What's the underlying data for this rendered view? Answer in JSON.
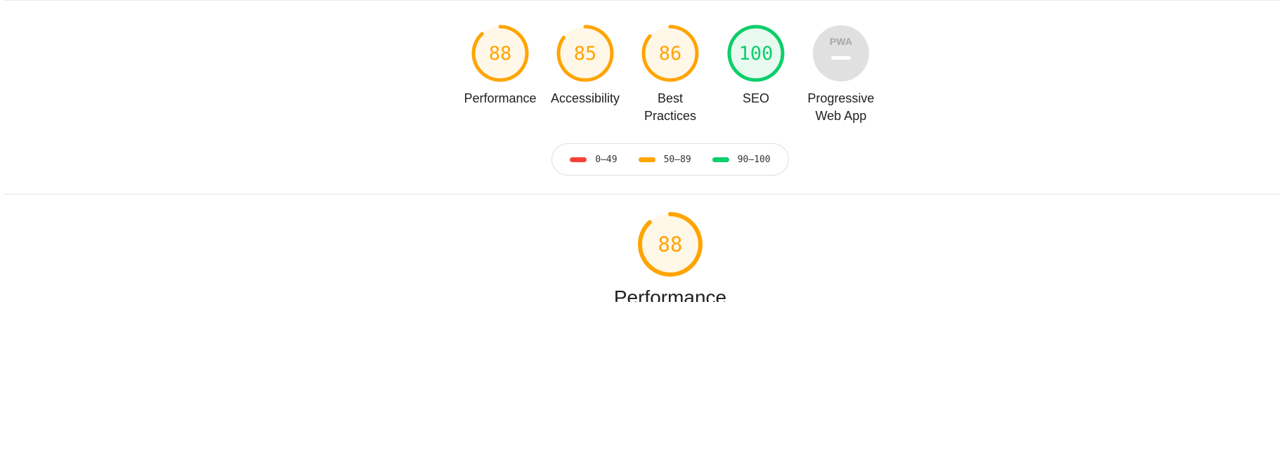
{
  "categories": [
    {
      "id": "performance",
      "label_lines": [
        "Performance"
      ],
      "score": "88",
      "rating": "average"
    },
    {
      "id": "accessibility",
      "label_lines": [
        "Accessibility"
      ],
      "score": "85",
      "rating": "average"
    },
    {
      "id": "best-practices",
      "label_lines": [
        "Best",
        "Practices"
      ],
      "score": "86",
      "rating": "average"
    },
    {
      "id": "seo",
      "label_lines": [
        "SEO"
      ],
      "score": "100",
      "rating": "pass"
    },
    {
      "id": "pwa",
      "label_lines": [
        "Progressive",
        "Web App"
      ],
      "score": null,
      "rating": "pwa",
      "badge_text": "PWA"
    }
  ],
  "legend": [
    {
      "range": "0–49",
      "color": "#f44336"
    },
    {
      "range": "50–89",
      "color": "#ffa400"
    },
    {
      "range": "90–100",
      "color": "#0cce6b"
    }
  ],
  "colors": {
    "average": "#ffa400",
    "average_fill": "#fff7e8",
    "pass": "#0cce6b",
    "pass_fill": "#e8faef",
    "pwa_fill": "#e0e0e0",
    "pwa_mark": "#ffffff",
    "pwa_text": "#a8a8a8"
  },
  "section": {
    "score": "88",
    "score_fraction": 0.88,
    "title": "Performance"
  }
}
